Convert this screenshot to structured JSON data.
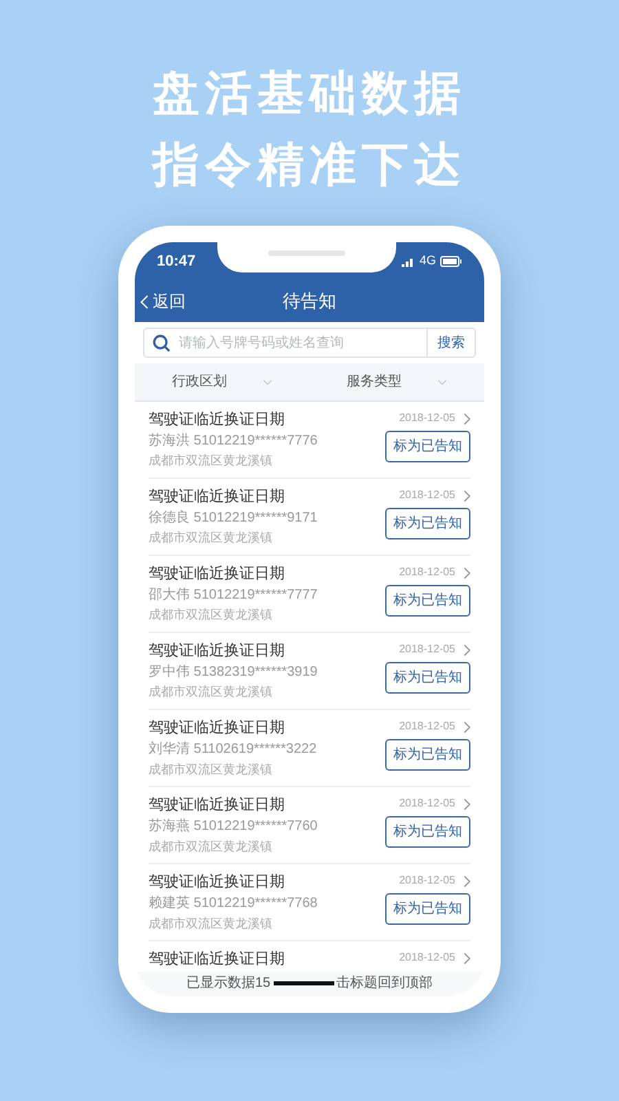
{
  "headline": [
    "盘活基础数据",
    "指令精准下达"
  ],
  "status_bar": {
    "time": "10:47",
    "network": "4G"
  },
  "nav": {
    "back": "返回",
    "title": "待告知"
  },
  "search": {
    "placeholder": "请输入号牌号码或姓名查询",
    "button": "搜索"
  },
  "filters": [
    "行政区划",
    "服务类型"
  ],
  "items": [
    {
      "title": "驾驶证临近换证日期",
      "person": "苏海洪 51012219******7776",
      "address": "成都市双流区黄龙溪镇",
      "date": "2018-12-05",
      "action": "标为已告知"
    },
    {
      "title": "驾驶证临近换证日期",
      "person": "徐德良 51012219******9171",
      "address": "成都市双流区黄龙溪镇",
      "date": "2018-12-05",
      "action": "标为已告知"
    },
    {
      "title": "驾驶证临近换证日期",
      "person": "邵大伟 51012219******7777",
      "address": "成都市双流区黄龙溪镇",
      "date": "2018-12-05",
      "action": "标为已告知"
    },
    {
      "title": "驾驶证临近换证日期",
      "person": "罗中伟 51382319******3919",
      "address": "成都市双流区黄龙溪镇",
      "date": "2018-12-05",
      "action": "标为已告知"
    },
    {
      "title": "驾驶证临近换证日期",
      "person": "刘华清 51102619******3222",
      "address": "成都市双流区黄龙溪镇",
      "date": "2018-12-05",
      "action": "标为已告知"
    },
    {
      "title": "驾驶证临近换证日期",
      "person": "苏海燕 51012219******7760",
      "address": "成都市双流区黄龙溪镇",
      "date": "2018-12-05",
      "action": "标为已告知"
    },
    {
      "title": "驾驶证临近换证日期",
      "person": "赖建英 51012219******7768",
      "address": "成都市双流区黄龙溪镇",
      "date": "2018-12-05",
      "action": "标为已告知"
    },
    {
      "title": "驾驶证临近换证日期",
      "date": "2018-12-05"
    }
  ],
  "footer": [
    "已显示数据15",
    "击标题回到顶部"
  ]
}
